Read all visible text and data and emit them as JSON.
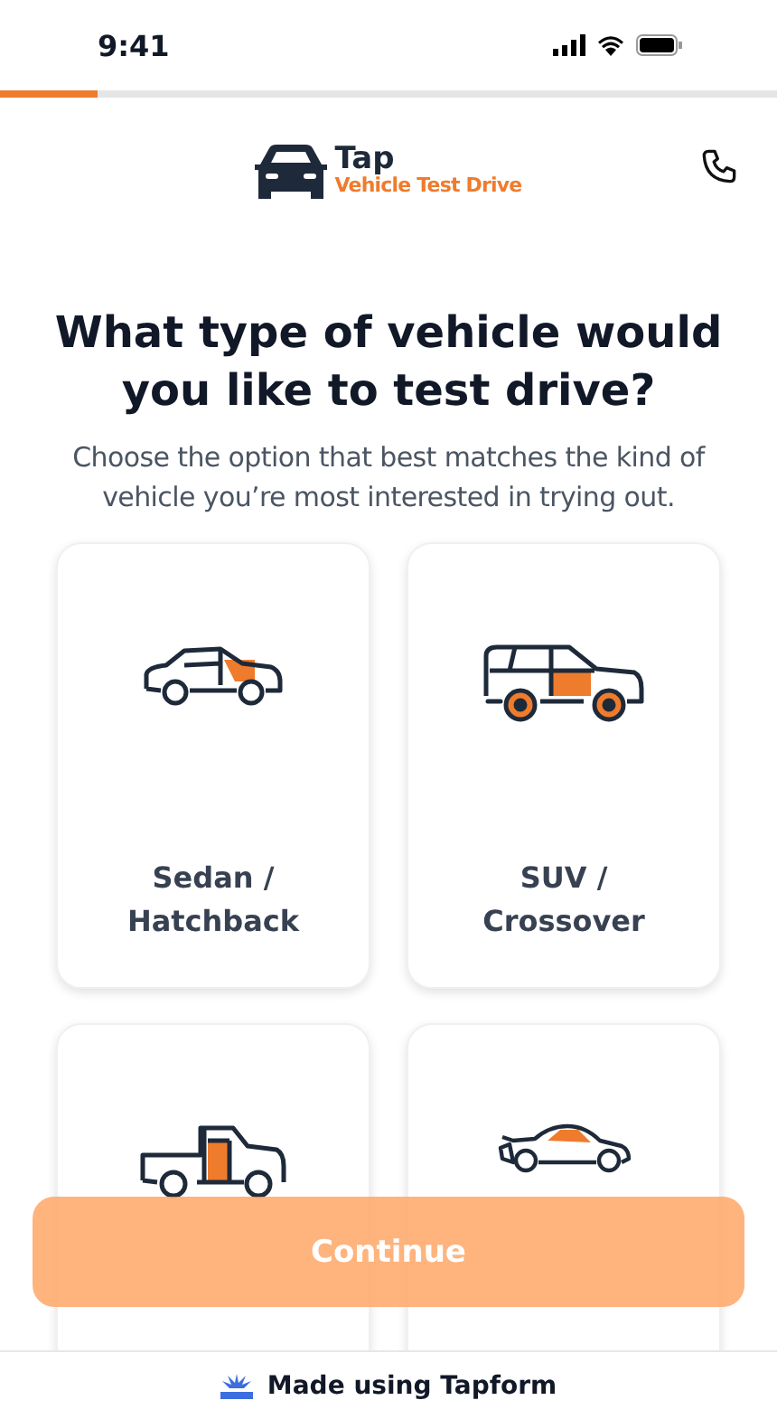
{
  "status_bar": {
    "time": "9:41"
  },
  "progress": {
    "level": 0.125
  },
  "header": {
    "brand": "Tap",
    "subtitle": "Vehicle Test Drive"
  },
  "question": {
    "title": "What type of vehicle would you like to test drive?",
    "description": "Choose the option that best matches the kind of vehicle you’re most interested in trying out."
  },
  "options": [
    {
      "kind": "sedan",
      "label": "Sedan / Hatchback",
      "selected": false
    },
    {
      "kind": "suv",
      "label": "SUV / Crossover",
      "selected": false
    },
    {
      "kind": "pickup",
      "selected": false
    },
    {
      "kind": "sports",
      "selected": false
    }
  ],
  "continue_button": {
    "label": "Continue",
    "disabled": true
  },
  "footer": {
    "text": "Made using Tapform"
  }
}
